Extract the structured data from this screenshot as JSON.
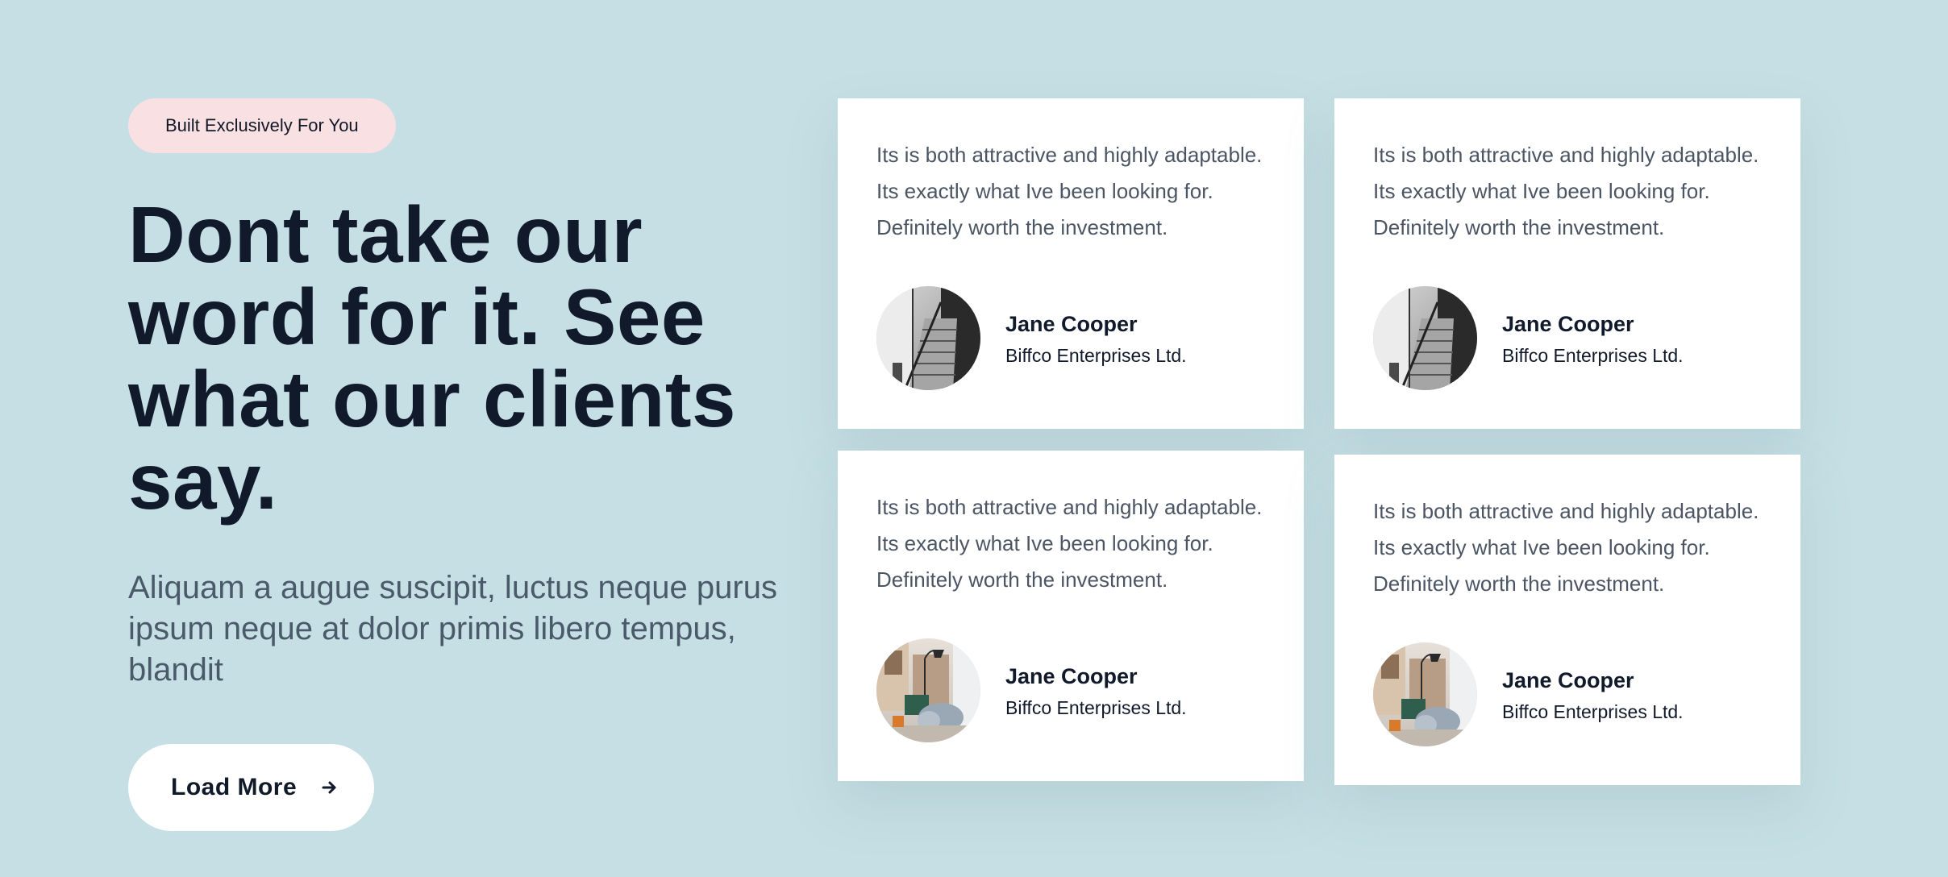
{
  "badge": "Built Exclusively For You",
  "headline": "Dont take our word for it. See what our clients say.",
  "subtext": "Aliquam a augue suscipit, luctus neque purus ipsum neque at dolor primis libero tempus, blandit",
  "load_more": {
    "label": "Load More",
    "icon": "arrow-right-icon"
  },
  "testimonials": [
    {
      "quote": "Its is both attractive and highly adaptable. Its exactly what Ive been looking for. Definitely worth the investment.",
      "name": "Jane Cooper",
      "company": "Biffco Enterprises Ltd.",
      "avatar": "staircase-photo"
    },
    {
      "quote": "Its is both attractive and highly adaptable. Its exactly what Ive been looking for. Definitely worth the investment.",
      "name": "Jane Cooper",
      "company": "Biffco Enterprises Ltd.",
      "avatar": "staircase-photo"
    },
    {
      "quote": "Its is both attractive and highly adaptable. Its exactly what Ive been looking for. Definitely worth the investment.",
      "name": "Jane Cooper",
      "company": "Biffco Enterprises Ltd.",
      "avatar": "living-room-photo"
    },
    {
      "quote": "Its is both attractive and highly adaptable. Its exactly what Ive been looking for. Definitely worth the investment.",
      "name": "Jane Cooper",
      "company": "Biffco Enterprises Ltd.",
      "avatar": "living-room-photo"
    }
  ],
  "colors": {
    "background": "#c5dfe4",
    "badge_bg": "#f9e0e2",
    "heading": "#111a2b",
    "body_text": "#4b5563"
  }
}
